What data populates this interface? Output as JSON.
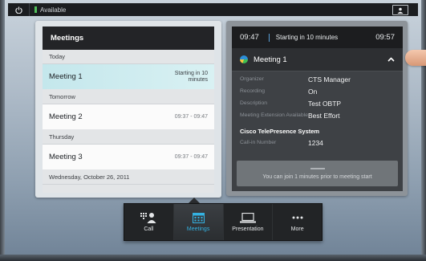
{
  "status_bar": {
    "status_text": "Available"
  },
  "meetings_panel": {
    "title": "Meetings",
    "groups": [
      {
        "label": "Today",
        "items": [
          {
            "title": "Meeting 1",
            "time_line1": "Starting in 10",
            "time_line2": "minutes"
          }
        ]
      },
      {
        "label": "Tomorrow",
        "items": [
          {
            "title": "Meeting 2",
            "time": "09:37 - 09:47"
          }
        ]
      },
      {
        "label": "Thursday",
        "items": [
          {
            "title": "Meeting 3",
            "time": "09:37 - 09:47"
          }
        ]
      },
      {
        "label": "Wednesday, October 26, 2011",
        "items": []
      }
    ]
  },
  "details_panel": {
    "start_time": "09:47",
    "starting_text": "Starting in 10 minutes",
    "end_time": "09:57",
    "meeting_title": "Meeting 1",
    "fields": [
      {
        "label": "Organizer",
        "value": "CTS Manager"
      },
      {
        "label": "Recording",
        "value": "On"
      },
      {
        "label": "Description",
        "value": "Test OBTP"
      },
      {
        "label": "Meeting Extension Available",
        "value": "Best Effort"
      }
    ],
    "section_title": "Cisco TelePresence System",
    "call_in": {
      "label": "Call-in Number",
      "value": "1234"
    },
    "join_message": "You can join 1 minutes prior to meeting start"
  },
  "nav": {
    "items": [
      {
        "label": "Call",
        "active": false
      },
      {
        "label": "Meetings",
        "active": true
      },
      {
        "label": "Presentation",
        "active": false
      },
      {
        "label": "More",
        "active": false
      }
    ]
  },
  "colors": {
    "accent": "#34b2e2",
    "available": "#51c05a",
    "selected_row": "#cdebef"
  }
}
